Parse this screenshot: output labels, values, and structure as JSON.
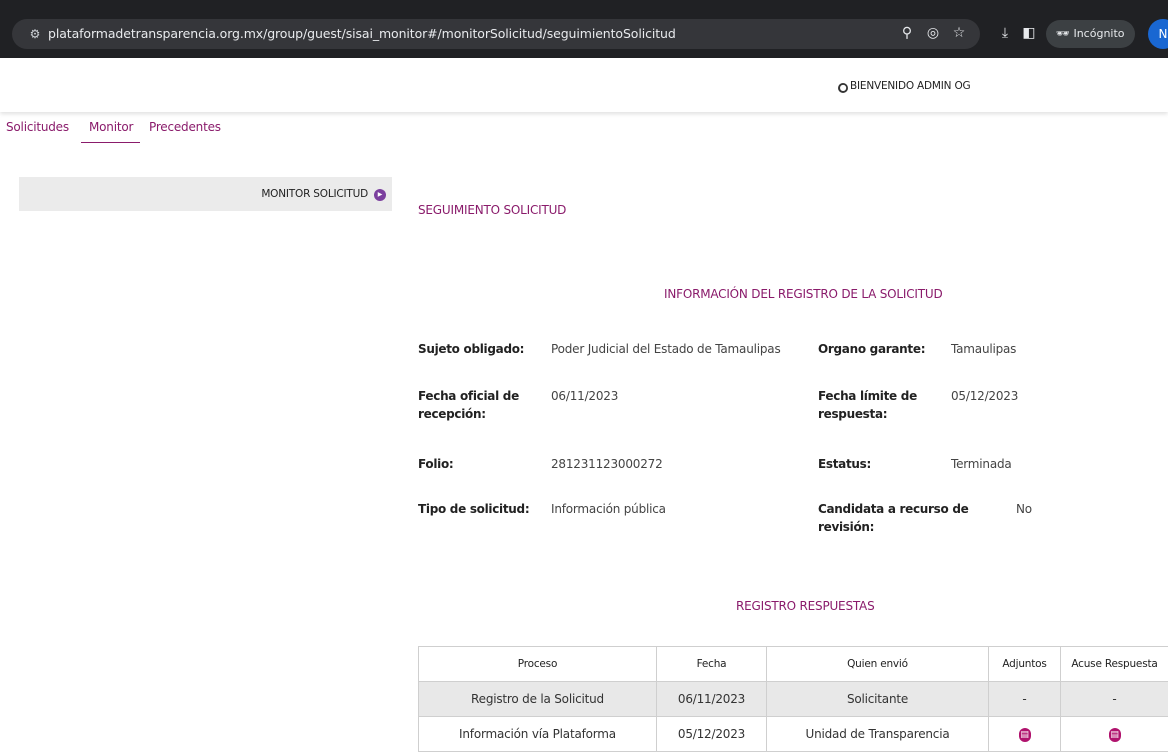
{
  "browser": {
    "url": "plataformadetransparencia.org.mx/group/guest/sisai_monitor#/monitorSolicitud/seguimientoSolicitud",
    "incognito_label": "Incógnito",
    "avatar_initial": "N"
  },
  "header": {
    "welcome": "BIENVENIDO ADMIN OG"
  },
  "nav": {
    "items": [
      "Solicitudes",
      "Monitor",
      "Precedentes"
    ],
    "active": "Monitor"
  },
  "sidebar": {
    "label": "MONITOR SOLICITUD"
  },
  "page": {
    "title": "SEGUIMIENTO SOLICITUD",
    "info_title": "INFORMACIÓN DEL REGISTRO DE LA SOLICITUD",
    "fields": {
      "sujeto_label": "Sujeto obligado:",
      "sujeto_value": "Poder Judicial del Estado de Tamaulipas",
      "organo_label": "Organo garante:",
      "organo_value": "Tamaulipas",
      "fecha_oficial_label": "Fecha oficial de recepción:",
      "fecha_oficial_value": "06/11/2023",
      "fecha_limite_label": "Fecha límite de respuesta:",
      "fecha_limite_value": "05/12/2023",
      "folio_label": "Folio:",
      "folio_value": "281231123000272",
      "estatus_label": "Estatus:",
      "estatus_value": "Terminada",
      "tipo_label": "Tipo de solicitud:",
      "tipo_value": "Información pública",
      "candidata_label": "Candidata a recurso de revisión:",
      "candidata_value": "No"
    },
    "responses_title": "REGISTRO RESPUESTAS",
    "table": {
      "headers": [
        "Proceso",
        "Fecha",
        "Quien envió",
        "Adjuntos",
        "Acuse Respuesta"
      ],
      "rows": [
        [
          "Registro de la Solicitud",
          "06/11/2023",
          "Solicitante",
          "-",
          "-"
        ],
        [
          "Información vía Plataforma",
          "05/12/2023",
          "Unidad de Transparencia",
          "",
          ""
        ]
      ]
    }
  },
  "colors": {
    "accent": "#8a1b6b",
    "icon": "#b0126d",
    "chrome": "#202124"
  }
}
